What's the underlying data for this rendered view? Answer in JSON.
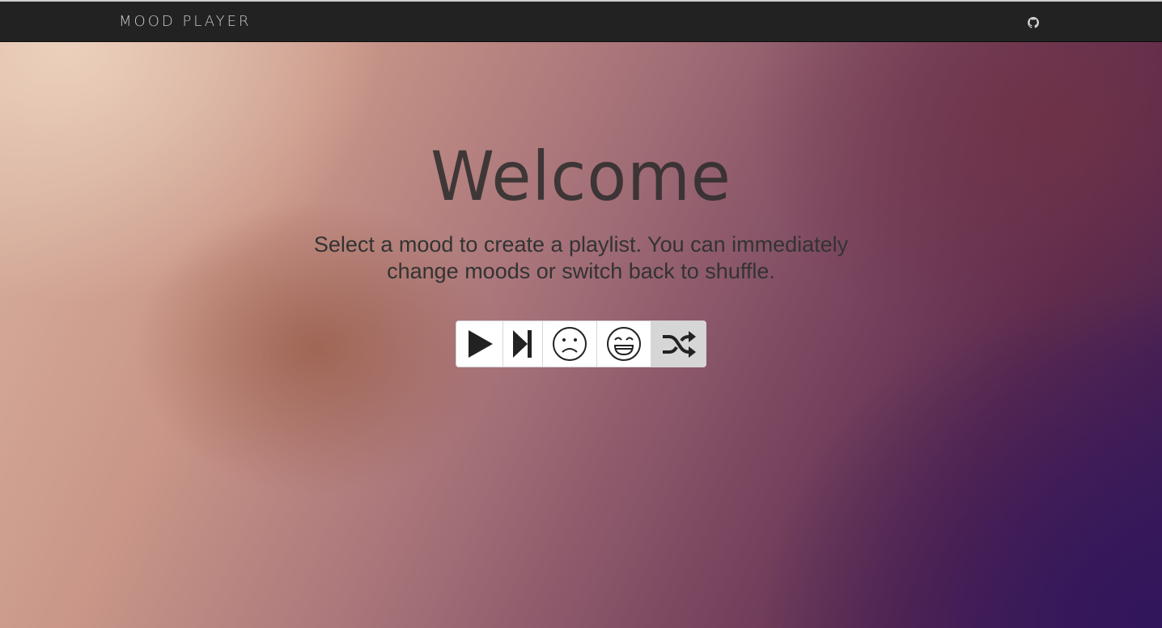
{
  "navbar": {
    "brand": "MOOD PLAYER",
    "github_icon": "github-icon"
  },
  "hero": {
    "title": "Welcome",
    "subtitle": "Select a mood to create a playlist. You can immediately change moods or switch back to shuffle."
  },
  "controls": [
    {
      "name": "play",
      "icon": "play-icon",
      "active": false
    },
    {
      "name": "next",
      "icon": "skip-next-icon",
      "active": false
    },
    {
      "name": "sad-mood",
      "icon": "sad-face-icon",
      "active": false
    },
    {
      "name": "happy-mood",
      "icon": "happy-face-icon",
      "active": false
    },
    {
      "name": "shuffle",
      "icon": "shuffle-icon",
      "active": true
    }
  ],
  "colors": {
    "navbar_bg": "#222222",
    "brand_text": "#c8c8c8",
    "control_active_bg": "#d6d6d6",
    "icon_color": "#222222"
  }
}
